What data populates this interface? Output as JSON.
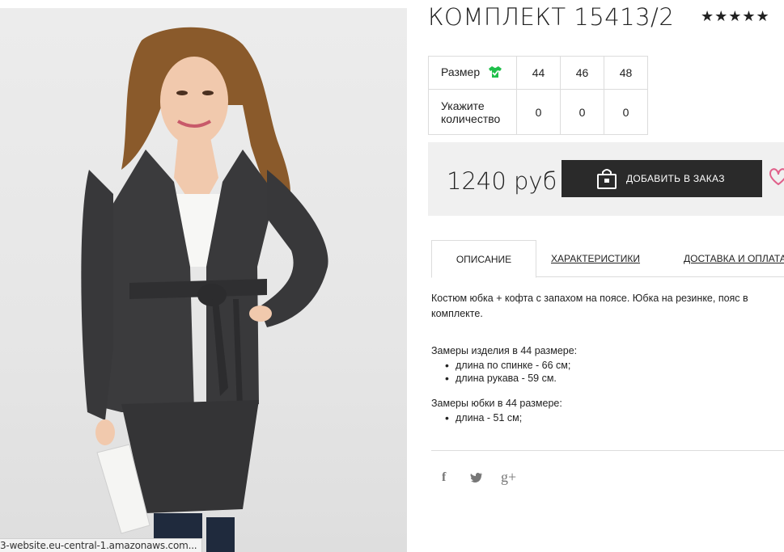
{
  "product": {
    "title": "КОМПЛЕКТ 15413/2",
    "rating_stars": "★★★★★",
    "rating_value": 5
  },
  "sizes": {
    "size_label": "Размер",
    "quantity_label": "Укажите количество",
    "columns": [
      "44",
      "46",
      "48"
    ],
    "quantities": [
      "0",
      "0",
      "0"
    ]
  },
  "buy": {
    "price": "1240 руб",
    "add_button_label": "ДОБАВИТЬ В ЗАКАЗ"
  },
  "tabs": [
    {
      "label": "ОПИСАНИЕ",
      "active": true
    },
    {
      "label": "ХАРАКТЕРИСТИКИ",
      "active": false
    },
    {
      "label": "ДОСТАВКА И ОПЛАТА",
      "active": false
    }
  ],
  "description": {
    "intro": "Костюм юбка + кофта с запахом на поясе. Юбка на резинке, пояс в комплекте.",
    "measure_head": "Замеры изделия в 44 размере:",
    "measure_items": [
      "длина по спинке - 66 см;",
      "длина рукава - 59 см."
    ],
    "skirt_head": "Замеры юбки в 44 размере:",
    "skirt_items": [
      "длина - 51 см;"
    ]
  },
  "social": {
    "facebook": "f",
    "twitter": "twitter-icon",
    "gplus": "g+"
  },
  "status_bar": {
    "url": "3-website.eu-central-1.amazonaws.com..."
  },
  "colors": {
    "accent_dark": "#2a2a2a",
    "size_icon_green": "#1fbf4a",
    "heart_pink": "#e0608a"
  }
}
